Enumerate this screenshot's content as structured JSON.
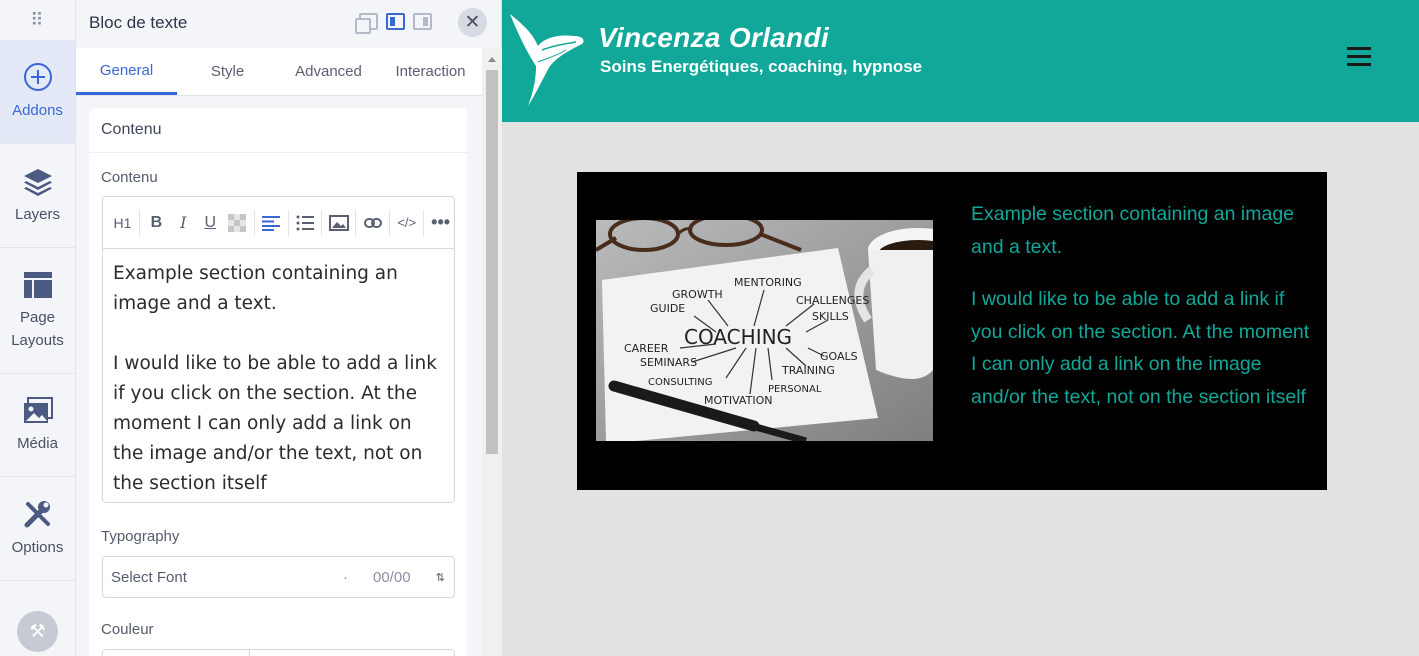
{
  "rail": {
    "items": [
      {
        "label": "Addons",
        "icon": "plus-circle-icon"
      },
      {
        "label": "Layers",
        "icon": "layers-icon"
      },
      {
        "label": "Page\nLayouts",
        "icon": "layout-icon"
      },
      {
        "label": "Média",
        "icon": "media-icon"
      },
      {
        "label": "Options",
        "icon": "tools-icon"
      }
    ]
  },
  "panel": {
    "title": "Bloc de texte",
    "tabs": [
      "General",
      "Style",
      "Advanced",
      "Interaction"
    ],
    "section_title": "Contenu",
    "content_label": "Contenu",
    "toolbar": {
      "heading": "H1",
      "bold": "B",
      "italic": "I",
      "underline": "U"
    },
    "editor_text": [
      "Example section containing an image and a text.",
      "I would like to be able to add a link if you click on the section. At the moment I can only add a link on the image and/or the text, not on the section itself"
    ],
    "typography_label": "Typography",
    "font_select": {
      "placeholder": "Select Font",
      "count": "00/00",
      "dot": "·"
    },
    "color_label": "Couleur"
  },
  "site": {
    "title": "Vincenza Orlandi",
    "tagline": "Soins Energétiques, coaching, hypnose",
    "header_color": "#11a89a",
    "section": {
      "paragraph1": "Example section containing an image and a text.",
      "paragraph2": "I would like to be able to add a link if you click on the section. At the moment I can only add a link on the image and/or the text, not on the section itself",
      "text_color": "#11a89a"
    },
    "image_words": {
      "center": "COACHING",
      "words": [
        "MENTORING",
        "GROWTH",
        "CHALLENGES",
        "GUIDE",
        "SKILLS",
        "CAREER",
        "GOALS",
        "SEMINARS",
        "TRAINING",
        "CONSULTING",
        "PERSONAL",
        "MOTIVATION"
      ]
    }
  }
}
